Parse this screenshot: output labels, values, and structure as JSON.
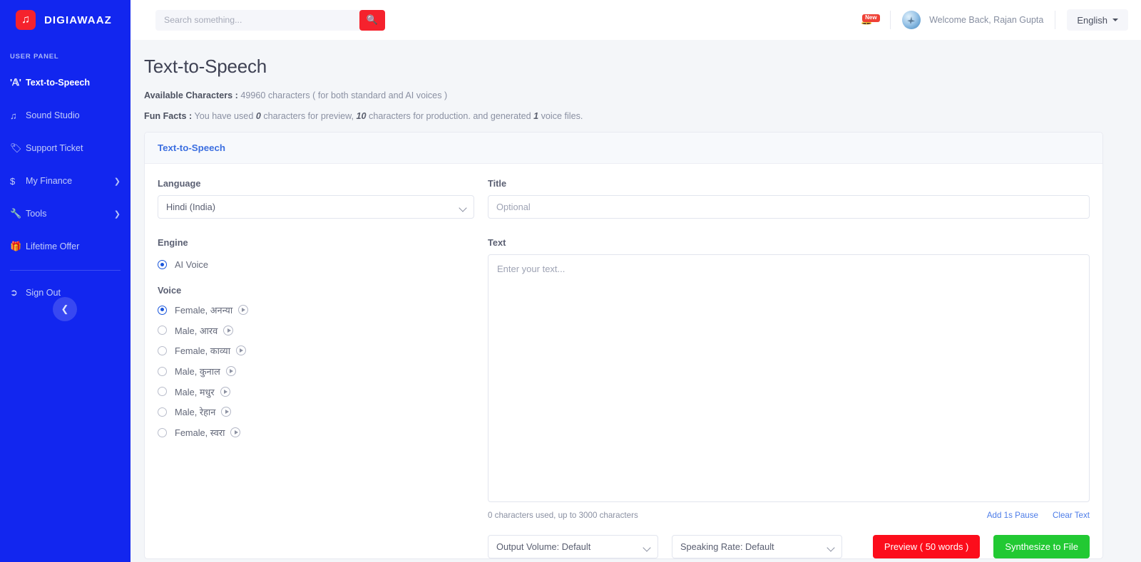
{
  "brand": {
    "name": "DIGIAWAAZ",
    "logo_icon": "music-note-icon",
    "accent": "#f5222d",
    "sidebar_bg": "#1226ef"
  },
  "sidebar": {
    "section_label": "USER PANEL",
    "items": [
      {
        "label": "Text-to-Speech",
        "icon": "text-to-speech-icon",
        "active": true,
        "has_caret": false
      },
      {
        "label": "Sound Studio",
        "icon": "music-note-icon",
        "active": false,
        "has_caret": false
      },
      {
        "label": "Support Ticket",
        "icon": "tag-icon",
        "active": false,
        "has_caret": false
      },
      {
        "label": "My Finance",
        "icon": "dollar-icon",
        "active": false,
        "has_caret": true
      },
      {
        "label": "Tools",
        "icon": "wrench-icon",
        "active": false,
        "has_caret": true
      },
      {
        "label": "Lifetime Offer",
        "icon": "gift-icon",
        "active": false,
        "has_caret": false
      }
    ],
    "signout": {
      "label": "Sign Out",
      "icon": "sign-out-icon"
    },
    "collapse_icon": "chevron-left-icon"
  },
  "topbar": {
    "search": {
      "placeholder": "Search something...",
      "value": "",
      "button_icon": "search-icon"
    },
    "notification": {
      "icon": "bell-icon",
      "badge": "New"
    },
    "avatar_name": "avatar",
    "welcome": "Welcome Back, Rajan Gupta",
    "language": {
      "label": "English",
      "caret_icon": "caret-down-icon"
    }
  },
  "page": {
    "title": "Text-to-Speech",
    "available": {
      "label": "Available Characters :",
      "count": "49960",
      "suffix": "characters ( for both standard and AI voices )"
    },
    "fun_facts": {
      "label": "Fun Facts :",
      "part1": "You have used",
      "preview_chars": "0",
      "part2": "characters for preview,",
      "production_chars": "10",
      "part3": "characters for production. and generated",
      "files": "1",
      "part4": "voice files."
    }
  },
  "card": {
    "header": "Text-to-Speech",
    "language": {
      "label": "Language",
      "value": "Hindi (India)"
    },
    "title_field": {
      "label": "Title",
      "placeholder": "Optional",
      "value": ""
    },
    "engine": {
      "label": "Engine",
      "options": [
        {
          "label": "AI Voice",
          "selected": true
        }
      ]
    },
    "voice": {
      "label": "Voice",
      "options": [
        {
          "label": "Female, अनन्या",
          "selected": true,
          "play_icon": "play-icon"
        },
        {
          "label": "Male, आरव",
          "selected": false,
          "play_icon": "play-icon"
        },
        {
          "label": "Female, काव्या",
          "selected": false,
          "play_icon": "play-icon"
        },
        {
          "label": "Male, कुनाल",
          "selected": false,
          "play_icon": "play-icon"
        },
        {
          "label": "Male, मधुर",
          "selected": false,
          "play_icon": "play-icon"
        },
        {
          "label": "Male, रेहान",
          "selected": false,
          "play_icon": "play-icon"
        },
        {
          "label": "Female, स्वरा",
          "selected": false,
          "play_icon": "play-icon"
        }
      ]
    },
    "text_field": {
      "label": "Text",
      "placeholder": "Enter your text...",
      "value": "",
      "counter": "0 characters used, up to 3000 characters",
      "add_pause_link": "Add 1s Pause",
      "clear_link": "Clear Text"
    },
    "controls": {
      "output_volume": "Output Volume: Default",
      "speaking_rate": "Speaking Rate: Default",
      "preview_button": "Preview ( 50 words )",
      "synthesize_button": "Synthesize to File",
      "preview_color": "#fc0d1b",
      "synthesize_color": "#22c933"
    }
  }
}
